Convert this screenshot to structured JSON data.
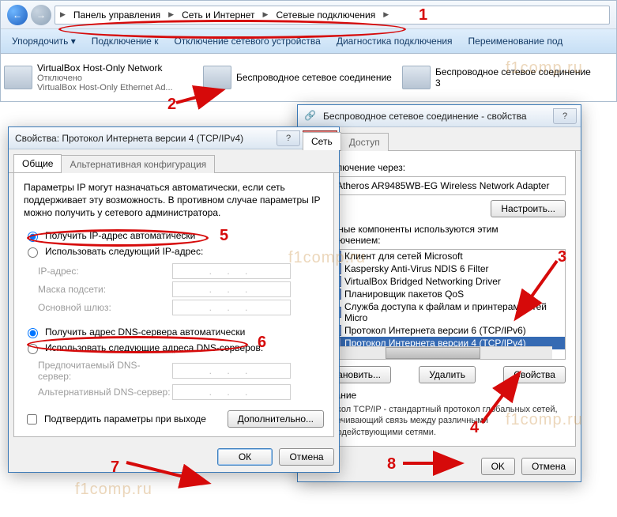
{
  "breadcrumb": {
    "seg1": "Панель управления",
    "seg2": "Сеть и Интернет",
    "seg3": "Сетевые подключения"
  },
  "toolbar": {
    "organize": "Упорядочить ▾",
    "connectto": "Подключение к",
    "disabledev": "Отключение сетевого устройства",
    "diag": "Диагностика подключения",
    "rename": "Переименование под"
  },
  "connections": {
    "c1": {
      "name": "VirtualBox Host-Only Network",
      "status": "Отключено",
      "adapter": "VirtualBox Host-Only Ethernet Ad..."
    },
    "c2": {
      "name": "Беспроводное сетевое соединение",
      "status": ""
    },
    "c3": {
      "name": "Беспроводное сетевое соединение 3",
      "status": ""
    }
  },
  "wireless_props": {
    "title": "Беспроводное сетевое соединение - свойства",
    "tab_net": "Сеть",
    "tab_access": "Доступ",
    "connect_via": "Отключение через:",
    "adapter": "Atheros AR9485WB-EG Wireless Network Adapter",
    "configure": "Настроить...",
    "components_label": "чеченные компоненты используются этим подключением:",
    "components": [
      "Клиент для сетей Microsoft",
      "Kaspersky Anti-Virus NDIS 6 Filter",
      "VirtualBox Bridged Networking Driver",
      "Планировщик пакетов QoS",
      "Служба доступа к файлам и принтерам сетей Micro",
      "Протокол Интернета версии 6 (TCP/IPv6)",
      "Протокол Интернета версии 4 (TCP/IPv4)"
    ],
    "install": "Установить...",
    "remove": "Удалить",
    "props": "Свойства",
    "desc_label": "Описание",
    "desc": "Протокол TCP/IP - стандартный протокол глобальных сетей, обеспечивающий связь между различными взаимодействующими сетями.",
    "ok": "OK",
    "cancel": "Отмена"
  },
  "ipv4_props": {
    "title": "Свойства: Протокол Интернета версии 4 (TCP/IPv4)",
    "tab_general": "Общие",
    "tab_alt": "Альтернативная конфигурация",
    "desc": "Параметры IP могут назначаться автоматически, если сеть поддерживает эту возможность. В противном случае параметры IP можно получить у сетевого администратора.",
    "radio_ip_auto": "Получить IP-адрес автоматически",
    "radio_ip_manual": "Использовать следующий IP-адрес:",
    "ip_addr": "IP-адрес:",
    "mask": "Маска подсети:",
    "gateway": "Основной шлюз:",
    "radio_dns_auto": "Получить адрес DNS-сервера автоматически",
    "radio_dns_manual": "Использовать следующие адреса DNS-серверов:",
    "dns1": "Предпочитаемый DNS-сервер:",
    "dns2": "Альтернативный DNS-сервер:",
    "confirm_exit": "Подтвердить параметры при выходе",
    "advanced": "Дополнительно...",
    "ok": "ОК",
    "cancel": "Отмена"
  },
  "annotations": {
    "1": "1",
    "2": "2",
    "3": "3",
    "4": "4",
    "5": "5",
    "6": "6",
    "7": "7",
    "8": "8"
  },
  "watermark": "f1comp.ru"
}
